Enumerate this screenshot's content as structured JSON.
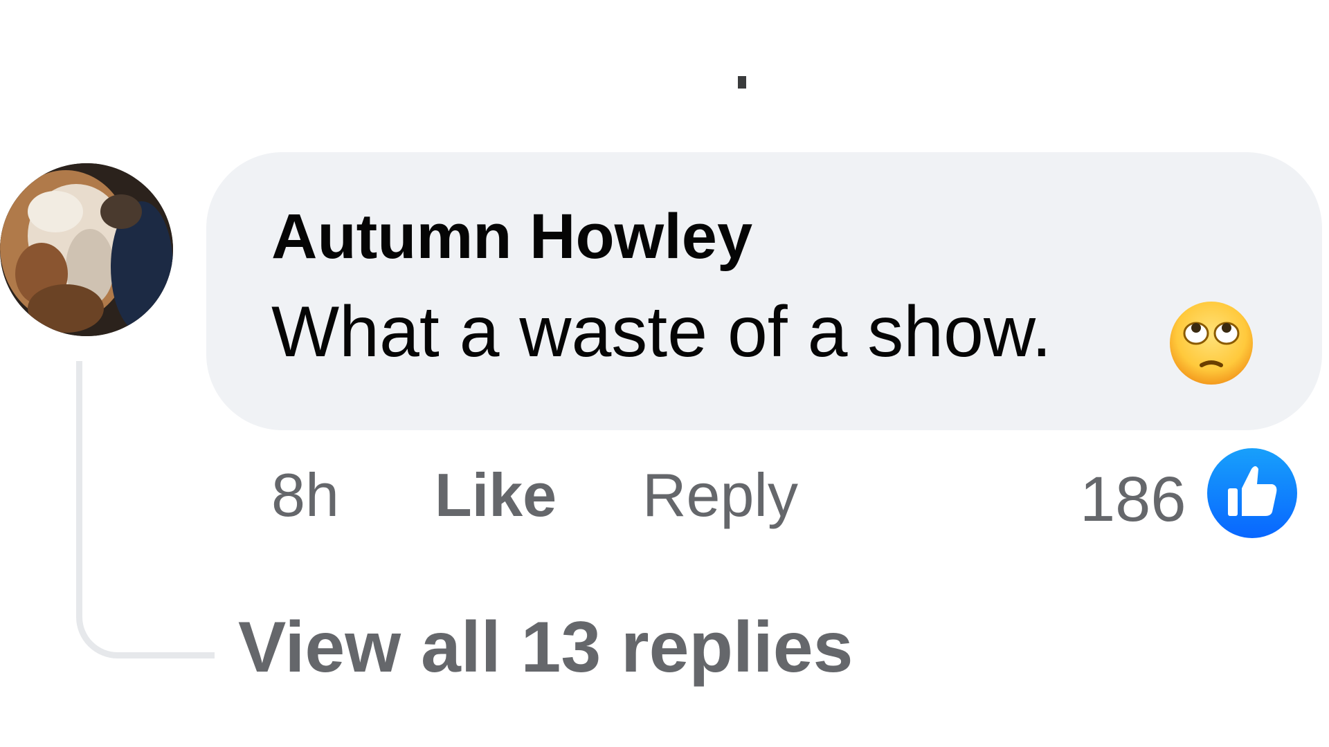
{
  "comment": {
    "author": "Autumn Howley",
    "text": "What a waste of a show.",
    "emoji": "face-with-rolling-eyes-icon"
  },
  "actions": {
    "time": "8h",
    "like_label": "Like",
    "reply_label": "Reply"
  },
  "reactions": {
    "count": "186",
    "icon": "thumbs-up-icon",
    "color": "#0866ff"
  },
  "replies": {
    "label": "View all 13 replies"
  },
  "colors": {
    "bubble": "#f0f2f5",
    "text": "#050505",
    "secondary_text": "#65676b"
  }
}
